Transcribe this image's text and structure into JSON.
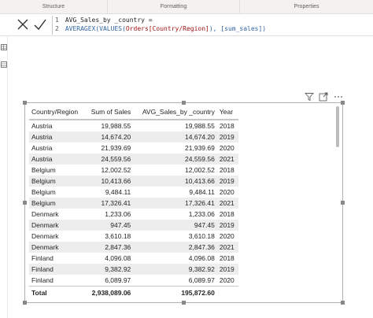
{
  "ribbon": {
    "tabs": [
      "Structure",
      "Formatting",
      "Properties"
    ]
  },
  "formula": {
    "line1_num": "1",
    "line1_text": "AVG_Sales_by _country =",
    "line2_num": "2",
    "line2_fn": "AVERAGEX(VALUES(",
    "line2_col": "Orders[Country/Region]",
    "line2_mid": "), ",
    "line2_meas": "[sum_sales]",
    "line2_end": ")"
  },
  "table": {
    "headers": [
      "Country/Region",
      "Sum of Sales",
      "AVG_Sales_by _country",
      "Year"
    ],
    "rows": [
      [
        "Austria",
        "19,988.55",
        "19,988.55",
        "2018"
      ],
      [
        "Austria",
        "14,674.20",
        "14,674.20",
        "2019"
      ],
      [
        "Austria",
        "21,939.69",
        "21,939.69",
        "2020"
      ],
      [
        "Austria",
        "24,559.56",
        "24,559.56",
        "2021"
      ],
      [
        "Belgium",
        "12,002.52",
        "12,002.52",
        "2018"
      ],
      [
        "Belgium",
        "10,413.66",
        "10,413.66",
        "2019"
      ],
      [
        "Belgium",
        "9,484.11",
        "9,484.11",
        "2020"
      ],
      [
        "Belgium",
        "17,326.41",
        "17,326.41",
        "2021"
      ],
      [
        "Denmark",
        "1,233.06",
        "1,233.06",
        "2018"
      ],
      [
        "Denmark",
        "947.45",
        "947.45",
        "2019"
      ],
      [
        "Denmark",
        "3,610.18",
        "3,610.18",
        "2020"
      ],
      [
        "Denmark",
        "2,847.36",
        "2,847.36",
        "2021"
      ],
      [
        "Finland",
        "4,096.08",
        "4,096.08",
        "2018"
      ],
      [
        "Finland",
        "9,382.92",
        "9,382.92",
        "2019"
      ],
      [
        "Finland",
        "6,089.97",
        "6,089.97",
        "2020"
      ]
    ],
    "total": [
      "Total",
      "2,938,089.06",
      "195,872.60",
      ""
    ]
  }
}
